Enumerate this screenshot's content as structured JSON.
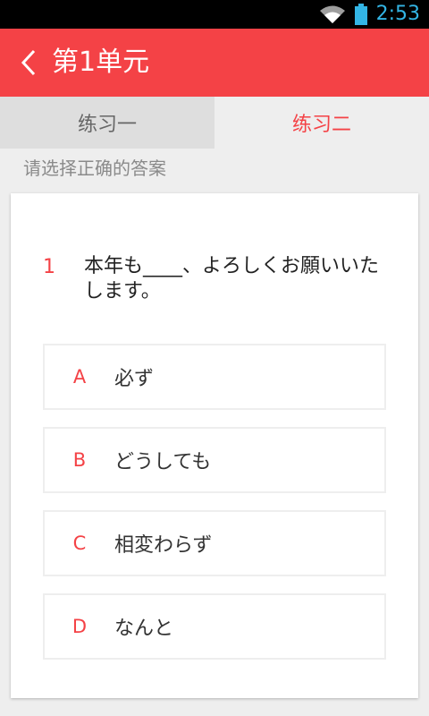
{
  "status_bar": {
    "time": "2:53",
    "icons": [
      "wifi-icon",
      "battery-icon"
    ]
  },
  "app_bar": {
    "title": "第1单元",
    "back_icon": "chevron-left-icon"
  },
  "tabs": [
    {
      "label": "练习一",
      "active": false
    },
    {
      "label": "练习二",
      "active": true
    }
  ],
  "instruction": "请选择正确的答案",
  "question": {
    "number": "1",
    "text": "本年も____、よろしくお願いいたします。",
    "options": [
      {
        "letter": "A",
        "text": "必ず"
      },
      {
        "letter": "B",
        "text": "どうしても"
      },
      {
        "letter": "C",
        "text": "相変わらず"
      },
      {
        "letter": "D",
        "text": "なんと"
      }
    ]
  },
  "colors": {
    "accent": "#f44246",
    "status_bar": "#000000",
    "clock": "#33b5e5"
  }
}
